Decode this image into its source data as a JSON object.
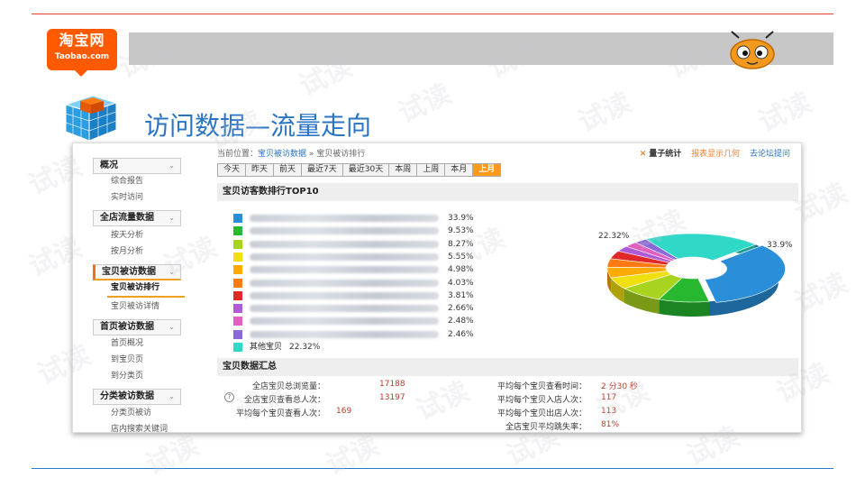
{
  "logo": {
    "line1": "淘宝网",
    "line2": "Taobao.com"
  },
  "page_title": "访问数据—流量走向",
  "breadcrumb": {
    "prefix": "当前位置：",
    "link": "宝贝被访数据",
    "sep": " » ",
    "current": "宝贝被访排行"
  },
  "top_right": {
    "stat": "量子统计",
    "orange_link": "报表显示几何",
    "blue_link": "去论坛提问"
  },
  "sidebar": {
    "groups": [
      {
        "label": "概况",
        "items": [
          "综合报告",
          "实时访问"
        ]
      },
      {
        "label": "全店流量数据",
        "items": [
          "按天分析",
          "按月分析"
        ]
      },
      {
        "label": "宝贝被访数据",
        "items": [
          "宝贝被访排行",
          "宝贝被访详情"
        ]
      },
      {
        "label": "首页被访数据",
        "items": [
          "首页概况",
          "到宝贝页",
          "到分类页"
        ]
      },
      {
        "label": "分类被访数据",
        "items": [
          "分类页被访",
          "店内搜索关键词"
        ]
      }
    ]
  },
  "tabs": [
    "今天",
    "昨天",
    "前天",
    "最近7天",
    "最近30天",
    "本周",
    "上周",
    "本月",
    "上月"
  ],
  "active_tab": "上月",
  "section1_title": "宝贝访客数排行TOP10",
  "section2_title": "宝贝数据汇总",
  "legend": {
    "colors": [
      "#2a8fd8",
      "#27b830",
      "#a8d420",
      "#f0e010",
      "#ffaa00",
      "#ff7a10",
      "#e02828",
      "#b05ad8",
      "#e060c0",
      "#8a6ad8"
    ],
    "percents": [
      "33.9%",
      "9.53%",
      "8.27%",
      "5.55%",
      "4.98%",
      "4.03%",
      "3.81%",
      "2.66%",
      "2.48%",
      "2.46%"
    ],
    "other_label": "其他宝贝",
    "other_pct": "22.32%",
    "other_color": "#30d8c8"
  },
  "pie": {
    "label_big": "33.9%",
    "label_other": "22.32%",
    "values": [
      33.9,
      9.53,
      8.27,
      5.55,
      4.98,
      4.03,
      3.81,
      2.66,
      2.48,
      2.46,
      22.32
    ]
  },
  "summary": {
    "left": [
      {
        "label": "全店宝贝总浏览量：",
        "value": "17188"
      },
      {
        "label": "全店宝贝查看总人次：",
        "value": "13197"
      },
      {
        "label": "平均每个宝贝查看人次：",
        "value": "169"
      }
    ],
    "right": [
      {
        "label": "平均每个宝贝查看时间：",
        "value": "2 分30 秒"
      },
      {
        "label": "平均每个宝贝入店人次：",
        "value": "117"
      },
      {
        "label": "平均每个宝贝出店人次：",
        "value": "113"
      },
      {
        "label": "全店宝贝平均跳失率：",
        "value": "81%"
      }
    ]
  },
  "watermark_text": "试读"
}
